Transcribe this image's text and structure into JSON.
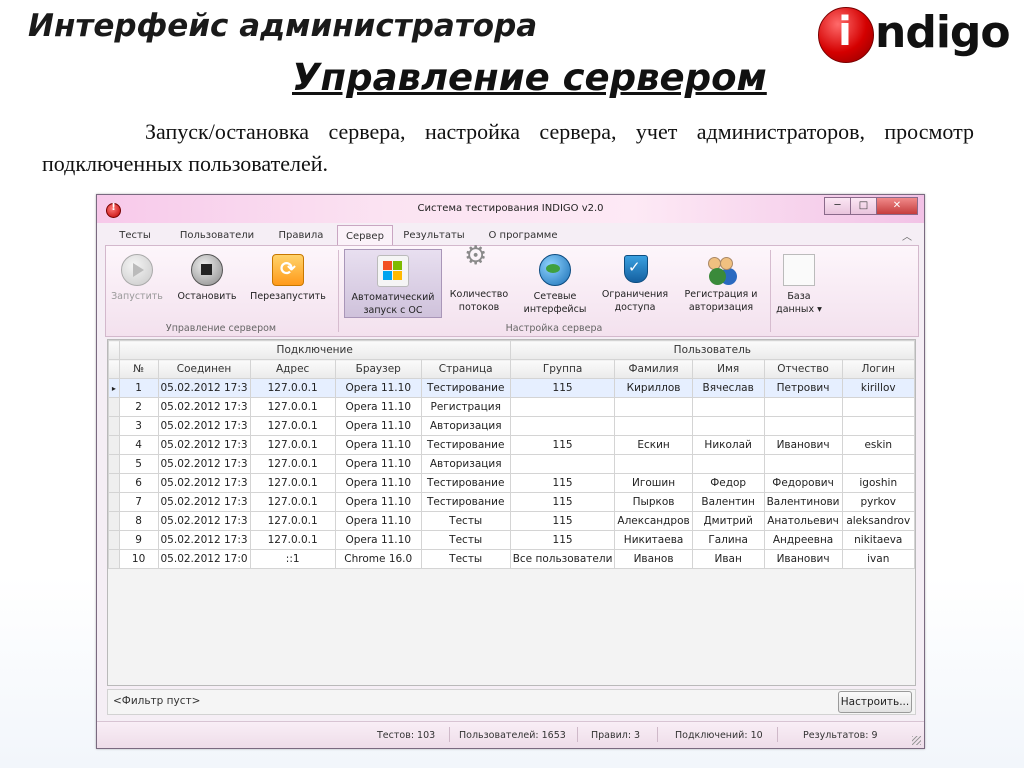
{
  "slide": {
    "title": "Интерфейс администратора",
    "subtitle": "Управление сервером",
    "description": "Запуск/остановка сервера, настройка сервера, учет администраторов, просмотр подключенных пользователей.",
    "logo_i": "i",
    "logo_text": "ndigo"
  },
  "window": {
    "title": "Система тестирования INDIGO v2.0",
    "minimize": "─",
    "maximize": "□",
    "close": "✕"
  },
  "tabs": [
    "Тесты",
    "Пользователи",
    "Правила",
    "Сервер",
    "Результаты",
    "О программе"
  ],
  "active_tab": "Сервер",
  "ribbon": {
    "groups": {
      "server_control": "Управление сервером",
      "server_settings": "Настройка сервера"
    },
    "buttons": {
      "start": "Запустить",
      "stop": "Остановить",
      "restart": "Перезапустить",
      "autostart": "Автоматический запуск с ОС",
      "threads": "Количество потоков",
      "network": "Сетевые интерфейсы",
      "access": "Ограничения доступа",
      "auth": "Регистрация и авторизация",
      "db": "База данных"
    }
  },
  "grid": {
    "group_headers": {
      "connection": "Подключение",
      "user": "Пользователь"
    },
    "columns": [
      "№",
      "Соединен",
      "Адрес",
      "Браузер",
      "Страница",
      "Группа",
      "Фамилия",
      "Имя",
      "Отчество",
      "Логин"
    ],
    "rows": [
      [
        "1",
        "05.02.2012 17:3",
        "127.0.0.1",
        "Opera 11.10",
        "Тестирование",
        "115",
        "Кириллов",
        "Вячеслав",
        "Петрович",
        "kirillov"
      ],
      [
        "2",
        "05.02.2012 17:3",
        "127.0.0.1",
        "Opera 11.10",
        "Регистрация",
        "",
        "",
        "",
        "",
        ""
      ],
      [
        "3",
        "05.02.2012 17:3",
        "127.0.0.1",
        "Opera 11.10",
        "Авторизация",
        "",
        "",
        "",
        "",
        ""
      ],
      [
        "4",
        "05.02.2012 17:3",
        "127.0.0.1",
        "Opera 11.10",
        "Тестирование",
        "115",
        "Ескин",
        "Николай",
        "Иванович",
        "eskin"
      ],
      [
        "5",
        "05.02.2012 17:3",
        "127.0.0.1",
        "Opera 11.10",
        "Авторизация",
        "",
        "",
        "",
        "",
        ""
      ],
      [
        "6",
        "05.02.2012 17:3",
        "127.0.0.1",
        "Opera 11.10",
        "Тестирование",
        "115",
        "Игошин",
        "Федор",
        "Федорович",
        "igoshin"
      ],
      [
        "7",
        "05.02.2012 17:3",
        "127.0.0.1",
        "Opera 11.10",
        "Тестирование",
        "115",
        "Пырков",
        "Валентин",
        "Валентинови",
        "pyrkov"
      ],
      [
        "8",
        "05.02.2012 17:3",
        "127.0.0.1",
        "Opera 11.10",
        "Тесты",
        "115",
        "Александров",
        "Дмитрий",
        "Анатольевич",
        "aleksandrov"
      ],
      [
        "9",
        "05.02.2012 17:3",
        "127.0.0.1",
        "Opera 11.10",
        "Тесты",
        "115",
        "Никитаева",
        "Галина",
        "Андреевна",
        "nikitaeva"
      ],
      [
        "10",
        "05.02.2012 17:0",
        "::1",
        "Chrome 16.0",
        "Тесты",
        "Все пользователи",
        "Иванов",
        "Иван",
        "Иванович",
        "ivan"
      ]
    ],
    "selected_row": 0,
    "row_indicator": "▸"
  },
  "filter": {
    "text": "<Фильтр пуст>",
    "configure_label": "Настроить..."
  },
  "status": {
    "tests": "Тестов: 103",
    "users": "Пользователей: 1653",
    "rules": "Правил: 3",
    "connections": "Подключений: 10",
    "results": "Результатов: 9"
  }
}
